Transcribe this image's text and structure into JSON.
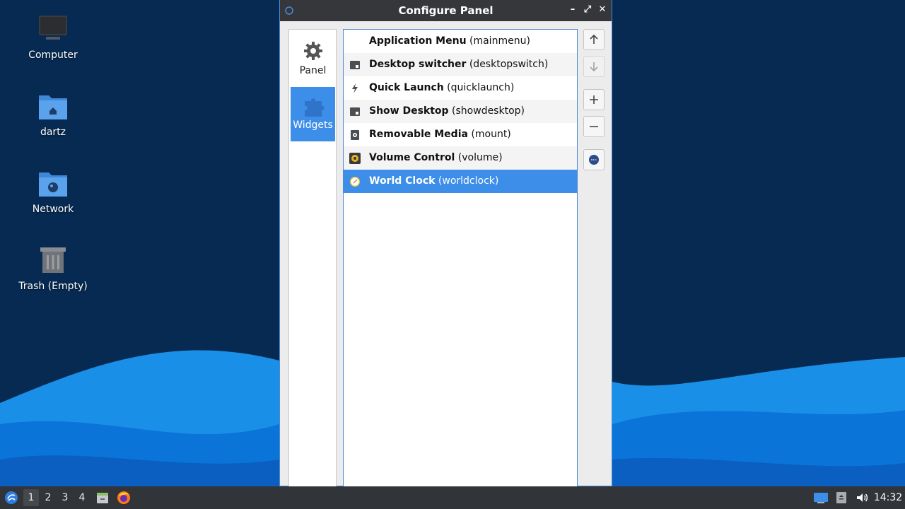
{
  "desktop": {
    "icons": [
      {
        "label": "Computer",
        "icon": "computer-icon"
      },
      {
        "label": "dartz",
        "icon": "home-folder-icon"
      },
      {
        "label": "Network",
        "icon": "network-folder-icon"
      },
      {
        "label": "Trash (Empty)",
        "icon": "trash-icon"
      }
    ]
  },
  "window": {
    "title": "Configure Panel",
    "controls": {
      "minimize": "–",
      "maximize": "⤢",
      "close": "✕"
    },
    "sidebar": [
      {
        "label": "Panel",
        "icon": "gear-icon",
        "active": false
      },
      {
        "label": "Widgets",
        "icon": "puzzle-icon",
        "active": true
      }
    ],
    "widgets": [
      {
        "name": "Application Menu",
        "id": "(mainmenu)",
        "icon": "none"
      },
      {
        "name": "Desktop switcher",
        "id": "(desktopswitch)",
        "icon": "desktop-switch-icon"
      },
      {
        "name": "Quick Launch",
        "id": "(quicklaunch)",
        "icon": "lightning-icon"
      },
      {
        "name": "Show Desktop",
        "id": "(showdesktop)",
        "icon": "show-desktop-icon"
      },
      {
        "name": "Removable Media",
        "id": "(mount)",
        "icon": "drive-icon"
      },
      {
        "name": "Volume Control",
        "id": "(volume)",
        "icon": "speaker-icon"
      },
      {
        "name": "World Clock",
        "id": "(worldclock)",
        "icon": "clock-icon",
        "selected": true
      }
    ],
    "tools": [
      {
        "name": "move-up",
        "icon": "arrow-up-icon"
      },
      {
        "name": "move-down",
        "icon": "arrow-down-icon"
      },
      {
        "name": "add",
        "icon": "plus-icon"
      },
      {
        "name": "remove",
        "icon": "minus-icon"
      },
      {
        "name": "configure",
        "icon": "preferences-icon"
      }
    ]
  },
  "taskbar": {
    "workspaces": [
      "1",
      "2",
      "3",
      "4"
    ],
    "active_workspace": "1",
    "clock": "14:32"
  },
  "colors": {
    "accent": "#3d8ee9",
    "desktop_bg": "#062a52",
    "taskbar_bg": "#313438",
    "titlebar_bg": "#35373b"
  }
}
